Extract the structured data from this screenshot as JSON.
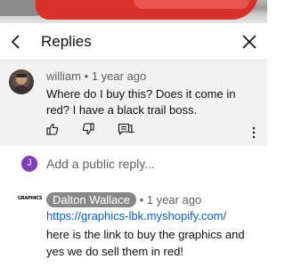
{
  "header": {
    "title": "Replies",
    "back_icon": "back-arrow-icon",
    "close_icon": "close-icon"
  },
  "comment": {
    "author": "william",
    "time": "1 year ago",
    "separator": "•",
    "text": "Where do I buy this? Does it come in red? I have a black trail boss.",
    "reply_count": "1",
    "icons": [
      "thumb-up-icon",
      "thumb-down-icon",
      "reply-icon",
      "more-vertical-icon"
    ]
  },
  "reply_box": {
    "avatar_letter": "J",
    "placeholder": "Add a public reply...",
    "avatar_color": "#7e3fb8"
  },
  "reply": {
    "logo_text": "GRAPHICS",
    "author": "Dalton Wallace",
    "separator": "•",
    "time": "1 year ago",
    "link": "https://graphics-lbk.myshopify.com/",
    "text": "here is the link to buy the graphics and yes we do sell them in red!",
    "chip_color": "#888888",
    "link_color": "#065fd4"
  }
}
